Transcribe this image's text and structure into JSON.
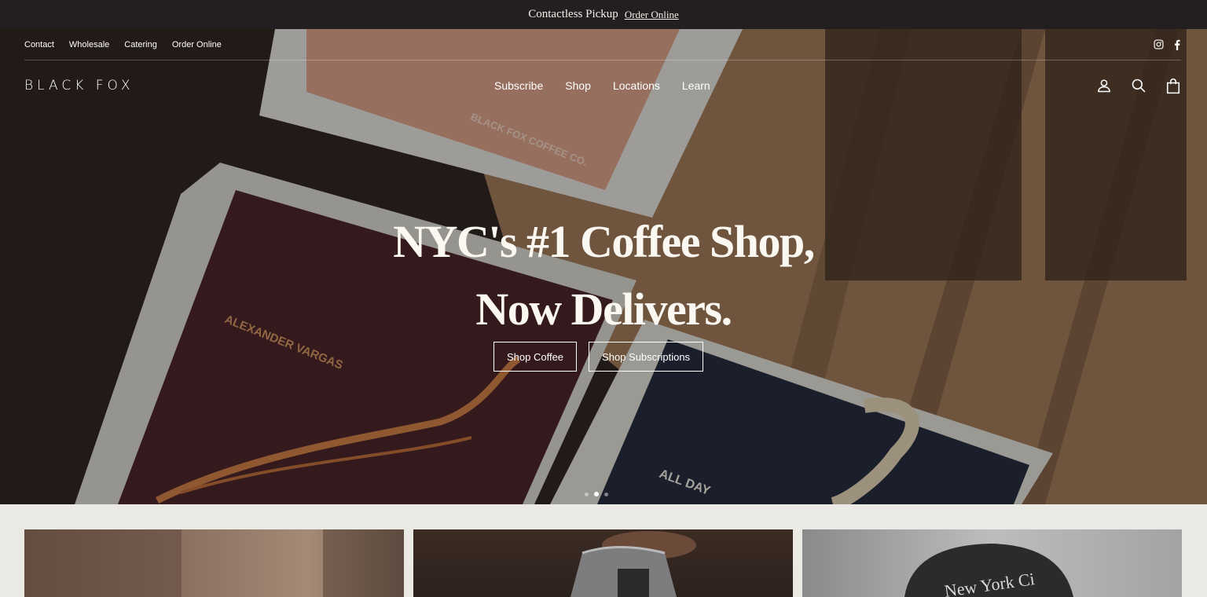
{
  "announcement": {
    "text": "Contactless Pickup",
    "link": "Order Online"
  },
  "utility_nav": [
    "Contact",
    "Wholesale",
    "Catering",
    "Order Online"
  ],
  "social": {
    "icons": [
      "instagram-icon",
      "facebook-icon"
    ]
  },
  "logo": "BLACK FOX",
  "main_nav": [
    "Subscribe",
    "Shop",
    "Locations",
    "Learn"
  ],
  "header_icons": [
    "account-icon",
    "search-icon",
    "cart-icon"
  ],
  "hero": {
    "headline_line1": "NYC's #1 Coffee Shop,",
    "headline_line2": "Now Delivers.",
    "buttons": [
      "Shop Coffee",
      "Shop Subscriptions"
    ],
    "bag_labels": {
      "top": "BLACK FOX COFFEE CO.",
      "left": "ALEXANDER VARGAS",
      "right": "ALL DAY"
    },
    "slides_total": 3,
    "slide_active": 2
  },
  "tiles": {
    "right_cap_text": "New York Ci"
  },
  "colors": {
    "announcement_bg": "#231f20",
    "page_bg": "#ebe9e3",
    "text_light": "#ffffff"
  }
}
